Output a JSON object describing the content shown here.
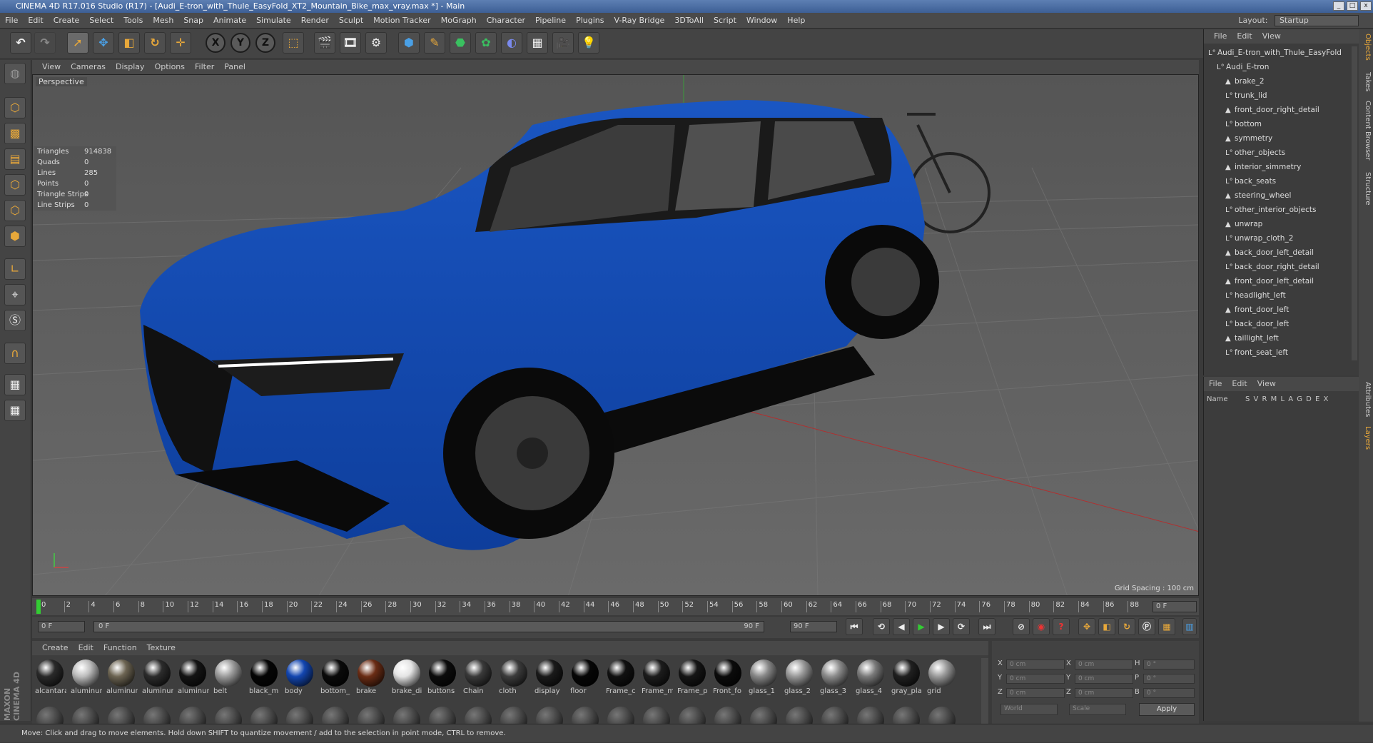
{
  "window": {
    "title": "CINEMA 4D R17.016 Studio (R17) - [Audi_E-tron_with_Thule_EasyFold_XT2_Mountain_Bike_max_vray.max *] - Main"
  },
  "menu": [
    "File",
    "Edit",
    "Create",
    "Select",
    "Tools",
    "Mesh",
    "Snap",
    "Animate",
    "Simulate",
    "Render",
    "Sculpt",
    "Motion Tracker",
    "MoGraph",
    "Character",
    "Pipeline",
    "Plugins",
    "V-Ray Bridge",
    "3DToAll",
    "Script",
    "Window",
    "Help"
  ],
  "layout": {
    "label": "Layout:",
    "value": "Startup"
  },
  "viewport": {
    "menu": [
      "View",
      "Cameras",
      "Display",
      "Options",
      "Filter",
      "Panel"
    ],
    "label": "Perspective",
    "grid_spacing": "Grid Spacing : 100 cm",
    "stats": [
      {
        "label": "Triangles",
        "value": "914838"
      },
      {
        "label": "Quads",
        "value": "0"
      },
      {
        "label": "Lines",
        "value": "285"
      },
      {
        "label": "Points",
        "value": "0"
      },
      {
        "label": "Triangle Strips",
        "value": "0"
      },
      {
        "label": "Line Strips",
        "value": "0"
      }
    ]
  },
  "timeline": {
    "ticks": [
      "0",
      "2",
      "4",
      "6",
      "8",
      "10",
      "12",
      "14",
      "16",
      "18",
      "20",
      "22",
      "24",
      "26",
      "28",
      "30",
      "32",
      "34",
      "36",
      "38",
      "40",
      "42",
      "44",
      "46",
      "48",
      "50",
      "52",
      "54",
      "56",
      "58",
      "60",
      "62",
      "64",
      "66",
      "68",
      "70",
      "72",
      "74",
      "76",
      "78",
      "80",
      "82",
      "84",
      "86",
      "88",
      "90"
    ],
    "current": "0 F",
    "start": "0 F",
    "range_start": "0 F",
    "range_end": "90 F",
    "end": "90 F"
  },
  "materials": {
    "menu": [
      "Create",
      "Edit",
      "Function",
      "Texture"
    ],
    "items": [
      {
        "name": "alcantara",
        "color": "#2a2a2a"
      },
      {
        "name": "aluminum",
        "color": "#bdbdbd"
      },
      {
        "name": "aluminum",
        "color": "#6c6452"
      },
      {
        "name": "aluminum",
        "color": "#2c2c2c"
      },
      {
        "name": "aluminum",
        "color": "#141414"
      },
      {
        "name": "belt",
        "color": "#9c9c9c"
      },
      {
        "name": "black_m",
        "color": "#050505"
      },
      {
        "name": "body",
        "color": "#1346b0"
      },
      {
        "name": "bottom_",
        "color": "#0a0a0a"
      },
      {
        "name": "brake",
        "color": "#6a2c14"
      },
      {
        "name": "brake_di",
        "color": "#e4e4e4"
      },
      {
        "name": "buttons",
        "color": "#0c0c0c"
      },
      {
        "name": "Chain",
        "color": "#3a3a3a"
      },
      {
        "name": "cloth",
        "color": "#3c3c3c"
      },
      {
        "name": "display",
        "color": "#1a1a1a"
      },
      {
        "name": "floor",
        "color": "#060606"
      },
      {
        "name": "Frame_c",
        "color": "#111"
      },
      {
        "name": "Frame_m",
        "color": "#1c1c1c"
      },
      {
        "name": "Frame_p",
        "color": "#151515"
      },
      {
        "name": "Front_fo",
        "color": "#0b0b0b"
      },
      {
        "name": "glass_1",
        "color": "#888"
      },
      {
        "name": "glass_2",
        "color": "#999"
      },
      {
        "name": "glass_3",
        "color": "#8c8c8c"
      },
      {
        "name": "glass_4",
        "color": "#7a7a7a"
      },
      {
        "name": "gray_pla",
        "color": "#202020"
      },
      {
        "name": "grid",
        "color": "#9a9a9a"
      }
    ]
  },
  "coords": {
    "rows": [
      {
        "a": "X",
        "av": "0 cm",
        "b": "X",
        "bv": "0 cm",
        "c": "H",
        "cv": "0 °"
      },
      {
        "a": "Y",
        "av": "0 cm",
        "b": "Y",
        "bv": "0 cm",
        "c": "P",
        "cv": "0 °"
      },
      {
        "a": "Z",
        "av": "0 cm",
        "b": "Z",
        "bv": "0 cm",
        "c": "B",
        "cv": "0 °"
      }
    ],
    "mode": "World",
    "scale": "Scale",
    "apply": "Apply"
  },
  "objects": {
    "menu": [
      "File",
      "Edit",
      "View"
    ],
    "tree": [
      {
        "name": "Audi_E-tron_with_Thule_EasyFold",
        "level": 0
      },
      {
        "name": "Audi_E-tron",
        "level": 1
      },
      {
        "name": "brake_2",
        "level": 2
      },
      {
        "name": "trunk_lid",
        "level": 2
      },
      {
        "name": "front_door_right_detail",
        "level": 2
      },
      {
        "name": "bottom",
        "level": 2
      },
      {
        "name": "symmetry",
        "level": 2
      },
      {
        "name": "other_objects",
        "level": 2
      },
      {
        "name": "interior_simmetry",
        "level": 2
      },
      {
        "name": "back_seats",
        "level": 2
      },
      {
        "name": "steering_wheel",
        "level": 2
      },
      {
        "name": "other_interior_objects",
        "level": 2
      },
      {
        "name": "unwrap",
        "level": 2
      },
      {
        "name": "unwrap_cloth_2",
        "level": 2
      },
      {
        "name": "back_door_left_detail",
        "level": 2
      },
      {
        "name": "back_door_right_detail",
        "level": 2
      },
      {
        "name": "front_door_left_detail",
        "level": 2
      },
      {
        "name": "headlight_left",
        "level": 2
      },
      {
        "name": "front_door_left",
        "level": 2
      },
      {
        "name": "back_door_left",
        "level": 2
      },
      {
        "name": "taillight_left",
        "level": 2
      },
      {
        "name": "front_seat_left",
        "level": 2
      }
    ]
  },
  "layers": {
    "menu": [
      "File",
      "Edit",
      "View"
    ],
    "name_col": "Name",
    "cols": "S V R M L A G D E X"
  },
  "side_tabs": [
    "Objects",
    "Takes",
    "Content Browser",
    "Structure",
    "Attributes",
    "Layers"
  ],
  "brand": "MAXON CINEMA 4D",
  "status": "Move: Click and drag to move elements. Hold down SHIFT to quantize movement / add to the selection in point mode, CTRL to remove."
}
